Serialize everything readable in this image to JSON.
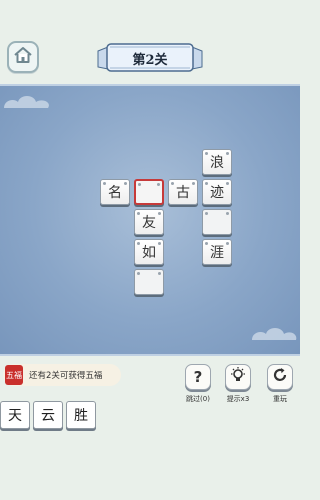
{
  "level": {
    "title": "第2关"
  },
  "board": {
    "cells": [
      {
        "id": "r0c5",
        "char": "浪"
      },
      {
        "id": "r1c2",
        "char": "名"
      },
      {
        "id": "r1c3",
        "char": "",
        "selected": true
      },
      {
        "id": "r1c4",
        "char": "古"
      },
      {
        "id": "r1c5",
        "char": "迹"
      },
      {
        "id": "r2c3",
        "char": "友"
      },
      {
        "id": "r2c5",
        "char": ""
      },
      {
        "id": "r3c3",
        "char": "如"
      },
      {
        "id": "r3c5",
        "char": "涯"
      },
      {
        "id": "r4c3",
        "char": ""
      }
    ]
  },
  "progress": {
    "badge": "五福",
    "text": "还有2关可获得五福"
  },
  "tools": {
    "hint": {
      "icon": "question-icon",
      "label": "跳过(0)"
    },
    "reveal": {
      "icon": "lightbulb-icon",
      "label": "提示x3"
    },
    "restart": {
      "icon": "restart-icon",
      "label": "重玩"
    }
  },
  "choices": [
    "天",
    "云",
    "胜"
  ],
  "colors": {
    "selected_border": "#c63a3a",
    "board": "#8aa6c8",
    "background": "#e9f0ea"
  }
}
